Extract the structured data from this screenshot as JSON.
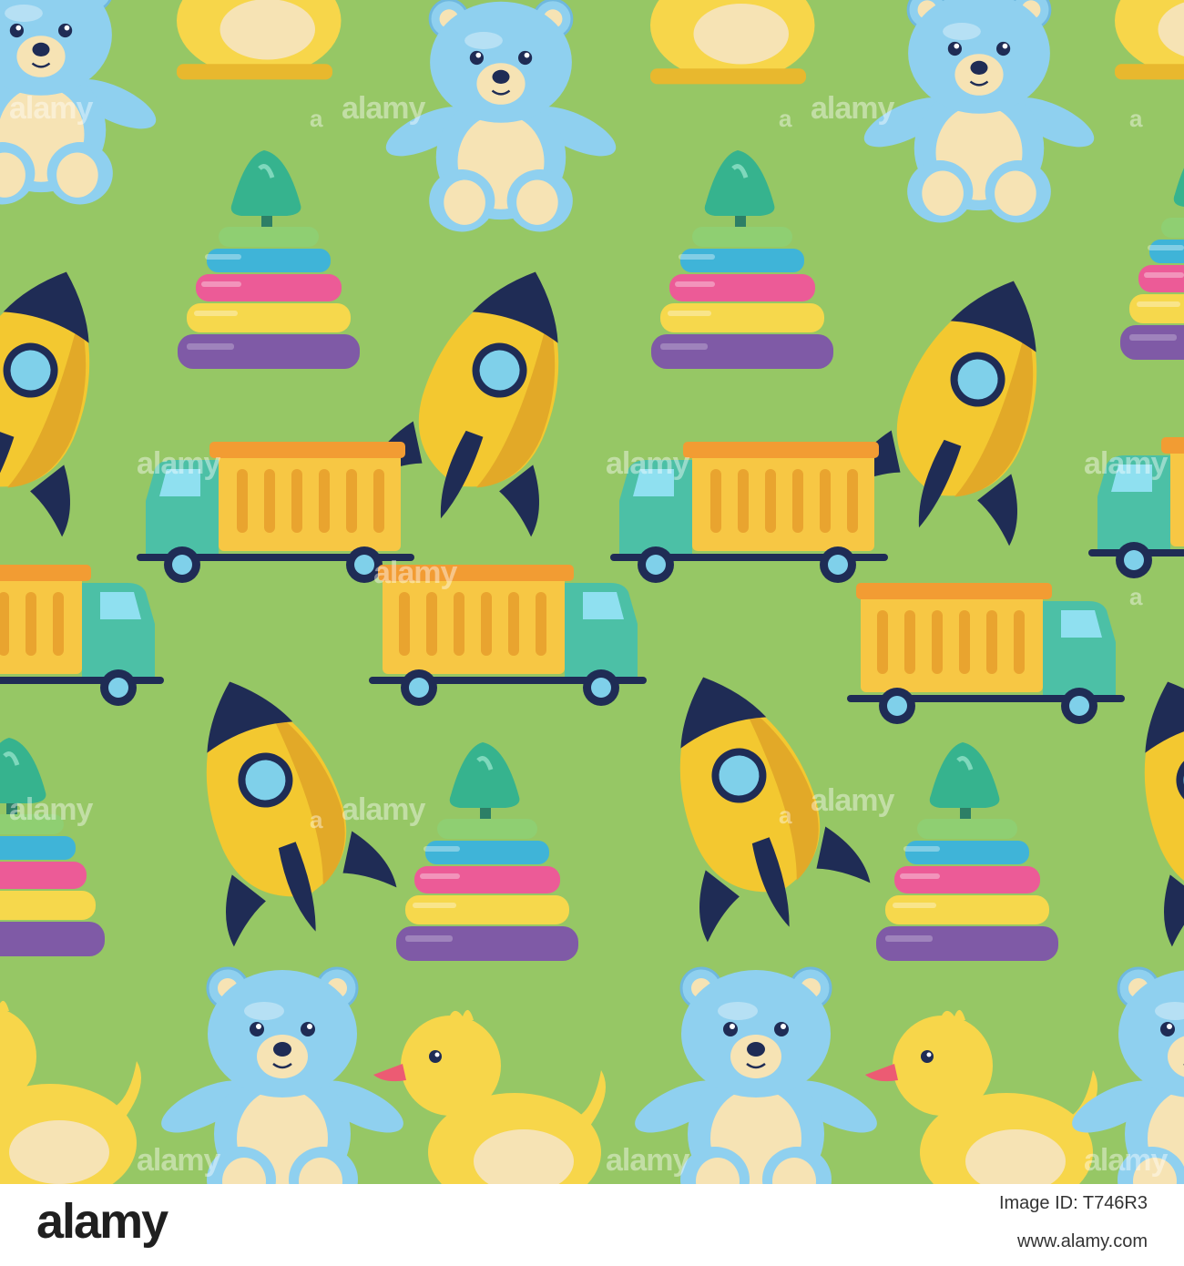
{
  "pattern": {
    "background_color": "#96c765",
    "watermark_text": "alamy",
    "watermark_letter": "a",
    "toys": [
      "teddy-bear",
      "rubber-duck",
      "stacking-ring-pyramid",
      "rocket",
      "dump-truck"
    ]
  },
  "footer": {
    "logo": "alamy",
    "image_id": "Image ID: T746R3",
    "url": "www.alamy.com"
  },
  "colors": {
    "bear_blue": "#8fd0ef",
    "bear_cream": "#f6e3b4",
    "duck_yellow": "#f7d64a",
    "rocket_yellow": "#f3c830",
    "rocket_navy": "#1f2c55",
    "truck_teal": "#4cc0a6",
    "truck_bed": "#f7c744",
    "ring_purple": "#7f5aa6",
    "ring_yellow": "#f6d84c",
    "ring_pink": "#ec5b97",
    "ring_blue": "#3fb4d8",
    "ring_green": "#8fcf72",
    "ring_cone": "#36b38e"
  }
}
